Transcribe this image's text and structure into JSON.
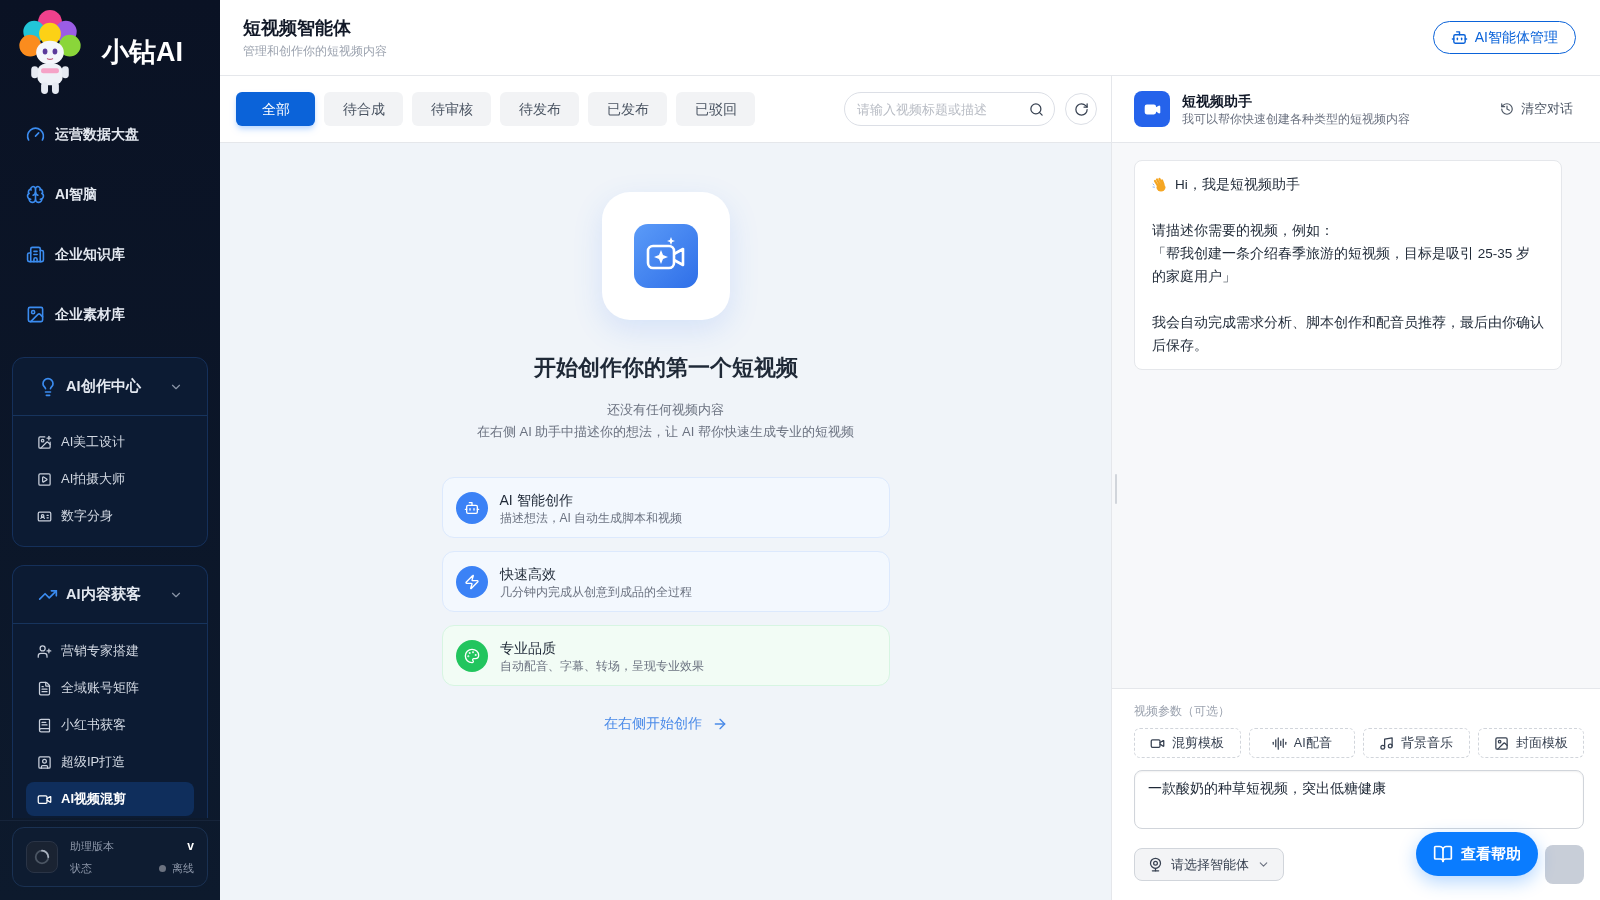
{
  "sidebar": {
    "brand": "小钻AI",
    "nav_items": [
      {
        "label": "运营数据大盘",
        "selected": false
      },
      {
        "label": "AI智脑",
        "selected": false
      },
      {
        "label": "企业知识库",
        "selected": false
      },
      {
        "label": "企业素材库",
        "selected": false
      }
    ],
    "groups": [
      {
        "title": "AI创作中心",
        "expanded": true,
        "items": [
          {
            "label": "AI美工设计",
            "selected": false
          },
          {
            "label": "AI拍摄大师",
            "selected": false
          },
          {
            "label": "数字分身",
            "selected": false
          }
        ]
      },
      {
        "title": "AI内容获客",
        "expanded": true,
        "items": [
          {
            "label": "营销专家搭建",
            "selected": false
          },
          {
            "label": "全域账号矩阵",
            "selected": false
          },
          {
            "label": "小红书获客",
            "selected": false
          },
          {
            "label": "超级IP打造",
            "selected": false
          },
          {
            "label": "AI视频混剪",
            "selected": true
          }
        ]
      }
    ],
    "footer": {
      "version_label": "助理版本",
      "version": "v",
      "status_label": "状态",
      "status": {
        "text": "离线",
        "online": false
      }
    }
  },
  "header": {
    "title": "短视频智能体",
    "subtitle": "管理和创作你的短视频内容",
    "button": "AI智能体管理"
  },
  "tabs": [
    {
      "label": "全部",
      "selected": true
    },
    {
      "label": "待合成",
      "selected": false
    },
    {
      "label": "待审核",
      "selected": false
    },
    {
      "label": "待发布",
      "selected": false
    },
    {
      "label": "已发布",
      "selected": false
    },
    {
      "label": "已驳回",
      "selected": false
    }
  ],
  "search": {
    "placeholder": "请输入视频标题或描述"
  },
  "empty_state": {
    "title": "开始创作你的第一个短视频",
    "lines": [
      "还没有任何视频内容",
      "在右侧 AI 助手中描述你的想法，让 AI 帮你快速生成专业的短视频"
    ],
    "features": [
      {
        "title": "AI 智能创作",
        "description": "描述想法，AI 自动生成脚本和视频",
        "color": "#3b82f6"
      },
      {
        "title": "快速高效",
        "description": "几分钟内完成从创意到成品的全过程",
        "color": "#3b82f6"
      },
      {
        "title": "专业品质",
        "description": "自动配音、字幕、转场，呈现专业效果",
        "color": "#22c55e"
      }
    ],
    "link": "在右侧开始创作"
  },
  "assistant": {
    "title": "短视频助手",
    "subtitle": "我可以帮你快速创建各种类型的短视频内容",
    "clear": "清空对话",
    "message": {
      "greeting": "Hi，我是短视频助手",
      "paragraphs": [
        [
          "请描述你需要的视频，例如：",
          "「帮我创建一条介绍春季旅游的短视频，目标是吸引 25-35 岁的家庭用户」"
        ],
        [
          "我会自动完成需求分析、脚本创作和配音员推荐，最后由你确认后保存。"
        ]
      ]
    }
  },
  "composer": {
    "params_label": "视频参数（可选）",
    "options": [
      "混剪模板",
      "AI配音",
      "背景音乐",
      "封面模板"
    ],
    "value": "一款酸奶的种草短视频，突出低糖健康",
    "agent_select": "请选择智能体"
  },
  "help_button": "查看帮助"
}
